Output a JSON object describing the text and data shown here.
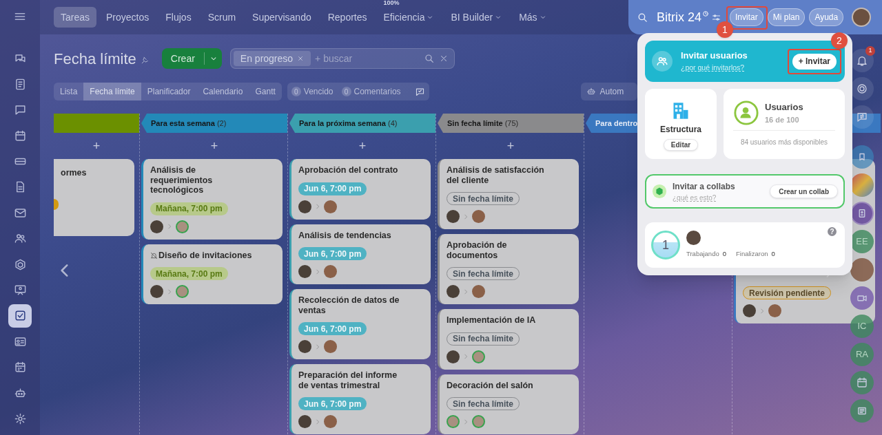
{
  "left_sidebar": {
    "items": [
      {
        "kind": "speech-bubbles",
        "selected": false
      },
      {
        "kind": "notebook",
        "selected": false
      },
      {
        "kind": "chat",
        "selected": false
      },
      {
        "kind": "calendar",
        "selected": false
      },
      {
        "kind": "drive",
        "selected": false
      },
      {
        "kind": "document",
        "selected": false
      },
      {
        "kind": "mail",
        "selected": false
      },
      {
        "kind": "people",
        "selected": false
      },
      {
        "kind": "hexagon",
        "selected": false
      },
      {
        "kind": "presentation",
        "selected": false
      },
      {
        "kind": "checkbox",
        "selected": true
      },
      {
        "kind": "id-card",
        "selected": false
      },
      {
        "kind": "calendar-grid",
        "selected": false
      },
      {
        "kind": "robot",
        "selected": false
      },
      {
        "kind": "gear",
        "selected": false
      }
    ]
  },
  "top_nav": {
    "tabs": [
      {
        "label": "Tareas",
        "selected": true,
        "dropdown": false
      },
      {
        "label": "Proyectos",
        "selected": false,
        "dropdown": false
      },
      {
        "label": "Flujos",
        "selected": false,
        "dropdown": false
      },
      {
        "label": "Scrum",
        "selected": false,
        "dropdown": false
      },
      {
        "label": "Supervisando",
        "selected": false,
        "dropdown": false
      },
      {
        "label": "Reportes",
        "selected": false,
        "dropdown": false
      },
      {
        "label": "Eficiencia",
        "selected": false,
        "dropdown": true,
        "badge": "100%"
      },
      {
        "label": "BI Builder",
        "selected": false,
        "dropdown": true
      },
      {
        "label": "Más",
        "selected": false,
        "dropdown": true
      }
    ]
  },
  "header": {
    "logo": "Bitrix 24",
    "buttons": [
      {
        "label": "Invitar"
      },
      {
        "label": "Mi plan"
      },
      {
        "label": "Ayuda"
      }
    ]
  },
  "page": {
    "title": "Fecha límite",
    "create_button": "Crear",
    "search": {
      "filter_chip": "En progreso",
      "placeholder": "+ buscar"
    },
    "view_tabs": [
      {
        "label": "Lista",
        "selected": false
      },
      {
        "label": "Fecha límite",
        "selected": true
      },
      {
        "label": "Planificador",
        "selected": false
      },
      {
        "label": "Calendario",
        "selected": false
      },
      {
        "label": "Gantt",
        "selected": false
      }
    ],
    "counters": [
      {
        "count": "0",
        "label": "Vencido"
      },
      {
        "count": "0",
        "label": "Comentarios"
      }
    ],
    "automation_button": "Autom"
  },
  "board": {
    "columns": [
      {
        "color": "#6b9000",
        "add": "+",
        "cards": [
          {
            "title": "ormes"
          }
        ]
      },
      {
        "title": "Para esta semana",
        "count": "(2)",
        "color": "#2389b8",
        "add": "+",
        "cards": [
          {
            "title": "Análisis de requerimientos tecnológicos",
            "muted": false,
            "deadline": {
              "kind": "soon",
              "text": "Mañana, 7:00 pm"
            },
            "people": [
              {
                "ring": false
              },
              {
                "ring": true
              }
            ]
          },
          {
            "title": "Diseño de invitaciones",
            "muted": true,
            "deadline": {
              "kind": "soon",
              "text": "Mañana, 7:00 pm"
            },
            "people": [
              {
                "ring": false
              },
              {
                "ring": true
              }
            ]
          }
        ]
      },
      {
        "title": "Para la próxima semana",
        "count": "(4)",
        "color": "#3b9fae",
        "add": "+",
        "cards": [
          {
            "title": "Aprobación del contrato",
            "muted": false,
            "deadline": {
              "kind": "week",
              "text": "Jun 6, 7:00 pm"
            },
            "people": [
              {
                "ring": false
              },
              {
                "ring": false
              }
            ]
          },
          {
            "title": "Análisis de tendencias",
            "muted": false,
            "deadline": {
              "kind": "week",
              "text": "Jun 6, 7:00 pm"
            },
            "people": [
              {
                "ring": false
              },
              {
                "ring": false
              }
            ]
          },
          {
            "title": "Recolección de datos de ventas",
            "muted": false,
            "deadline": {
              "kind": "week",
              "text": "Jun 6, 7:00 pm"
            },
            "people": [
              {
                "ring": false
              },
              {
                "ring": false
              }
            ]
          },
          {
            "title": "Preparación del informe de ventas trimestral",
            "muted": false,
            "deadline": {
              "kind": "week",
              "text": "Jun 6, 7:00 pm"
            },
            "people": [
              {
                "ring": false
              },
              {
                "ring": false
              }
            ]
          }
        ]
      },
      {
        "title": "Sin fecha límite",
        "count": "(75)",
        "color": "#8a8a8c",
        "add": "+",
        "cards": [
          {
            "title": "Análisis de satisfacción del cliente",
            "muted": false,
            "deadline": {
              "kind": "none",
              "text": "Sin fecha límite"
            },
            "people": [
              {
                "ring": false
              },
              {
                "ring": false
              }
            ]
          },
          {
            "title": "Aprobación de documentos",
            "muted": false,
            "deadline": {
              "kind": "none",
              "text": "Sin fecha límite"
            },
            "people": [
              {
                "ring": false
              },
              {
                "ring": false
              }
            ]
          },
          {
            "title": "Implementación de IA",
            "muted": false,
            "deadline": {
              "kind": "none",
              "text": "Sin fecha límite"
            },
            "people": [
              {
                "ring": false
              },
              {
                "ring": true
              }
            ]
          },
          {
            "title": "Decoración del salón",
            "muted": false,
            "deadline": {
              "kind": "none",
              "text": "Sin fecha límite"
            },
            "people": [
              {
                "ring": true
              },
              {
                "ring": true
              }
            ]
          }
        ]
      },
      {
        "title": "Para dentro",
        "color": "#3a78c0"
      },
      {
        "color": "#3a78c0",
        "cards": [
          {
            "deadline": {
              "kind": "review",
              "text": "Revisión pendiente"
            },
            "people": [
              {
                "ring": false
              },
              {
                "ring": false
              }
            ]
          }
        ]
      }
    ]
  },
  "invite_popup": {
    "banner": {
      "title": "Invitar usuarios",
      "link": "¿por qué invitarlos?",
      "button": "+ Invitar"
    },
    "structure": {
      "title": "Estructura",
      "button": "Editar"
    },
    "users": {
      "title": "Usuarios",
      "count": "16 de 100",
      "note": "84 usuarios más disponibles"
    },
    "collabs": {
      "title": "Invitar a collabs",
      "link": "¿qué es esto?",
      "button": "Crear un collab"
    },
    "stats": {
      "number": "1",
      "help": "?",
      "items": [
        {
          "label": "Trabajando",
          "value": "0"
        },
        {
          "label": "Finalizaron",
          "value": "0"
        }
      ]
    }
  },
  "right_rail": {
    "items": [
      {
        "kind": "bell",
        "badge": "1"
      },
      {
        "kind": "target"
      },
      {
        "kind": "chat-arrows"
      },
      {
        "kind": "bookmark"
      },
      {
        "kind": "image"
      },
      {
        "kind": "contact-book"
      },
      {
        "kind": "initials",
        "text": "EE"
      },
      {
        "kind": "avatar"
      },
      {
        "kind": "video"
      },
      {
        "kind": "initials",
        "text": "IC"
      },
      {
        "kind": "initials",
        "text": "RA"
      },
      {
        "kind": "calendar"
      },
      {
        "kind": "newspaper"
      }
    ]
  },
  "callouts": [
    {
      "label": "1"
    },
    {
      "label": "2"
    }
  ]
}
